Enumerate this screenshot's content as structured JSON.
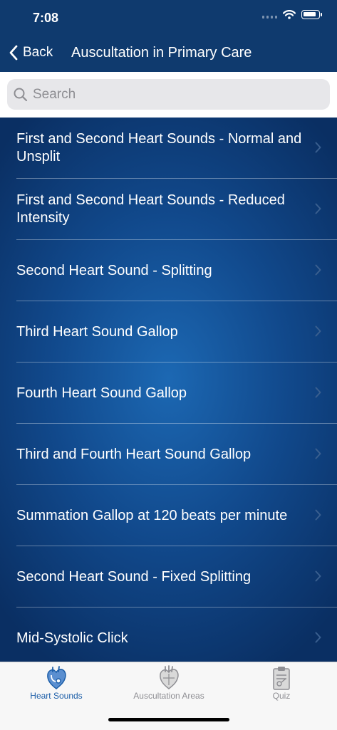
{
  "status": {
    "time": "7:08"
  },
  "nav": {
    "back_label": "Back",
    "title": "Auscultation in Primary Care"
  },
  "search": {
    "placeholder": "Search"
  },
  "items": [
    {
      "label": "First and Second Heart Sounds - Normal and Unsplit"
    },
    {
      "label": "First and Second Heart Sounds - Reduced Intensity"
    },
    {
      "label": "Second Heart Sound - Splitting"
    },
    {
      "label": "Third Heart Sound Gallop"
    },
    {
      "label": "Fourth Heart Sound Gallop"
    },
    {
      "label": "Third and Fourth Heart Sound Gallop"
    },
    {
      "label": "Summation Gallop at 120 beats per minute"
    },
    {
      "label": "Second Heart Sound - Fixed Splitting"
    },
    {
      "label": "Mid-Systolic Click"
    }
  ],
  "tabs": [
    {
      "label": "Heart Sounds",
      "icon": "heart-stethoscope-icon",
      "active": true
    },
    {
      "label": "Auscultation Areas",
      "icon": "heart-anatomy-icon",
      "active": false
    },
    {
      "label": "Quiz",
      "icon": "clipboard-icon",
      "active": false
    }
  ],
  "colors": {
    "nav_bar": "#0f3a6e",
    "accent": "#1c5ea8",
    "list_center": "#1c68b3"
  }
}
